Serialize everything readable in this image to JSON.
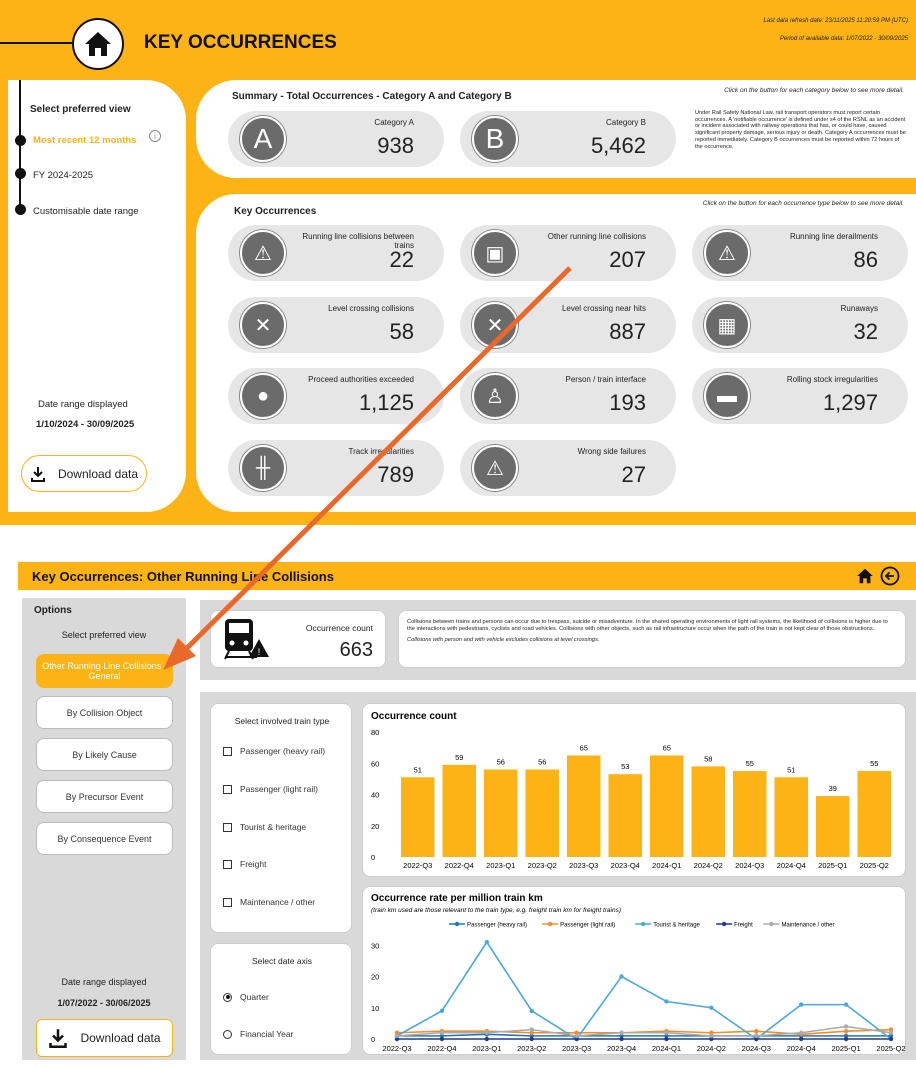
{
  "header": {
    "title": "KEY OCCURRENCES",
    "refresh": "Last data refresh date: 23/11/2025 11:20:59 PM (UTC)",
    "period": "Period of available data: 1/07/2022 - 30/09/2025"
  },
  "sidebar": {
    "heading": "Select preferred view",
    "options": [
      "Most recent 12 months",
      "FY 2024-2025",
      "Customisable date range"
    ],
    "range_label": "Date range displayed",
    "range_value": "1/10/2024 - 30/09/2025",
    "download": "Download data"
  },
  "summary": {
    "title": "Summary - Total Occurrences - Category A and Category B",
    "hint": "Click on the button for each category below to see more detail.",
    "desc": "Under Rail Safety National Law, rail transport operators must report certain occurrences. A 'notifiable occurrence' is defined under s4 of the RSNL as an accident or incident associated with railway operations that has, or could have, caused significant property damage, serious injury or death. Category A occurrences must be reported immediately. Category B occurrences must be reported within 72 hours of the occurrence.",
    "catA": {
      "icon": "A",
      "label": "Category A",
      "value": "938"
    },
    "catB": {
      "icon": "B",
      "label": "Category B",
      "value": "5,462"
    }
  },
  "key": {
    "title": "Key Occurrences",
    "hint": "Click on the button for each occurrence type below to see more detail.",
    "items": [
      {
        "label": "Running line collisions between trains",
        "value": "22",
        "icon": "train-collision-icon"
      },
      {
        "label": "Other running line collisions",
        "value": "207",
        "icon": "train-hazard-icon"
      },
      {
        "label": "Running line derailments",
        "value": "86",
        "icon": "derailment-icon"
      },
      {
        "label": "Level crossing collisions",
        "value": "58",
        "icon": "level-crossing-collision-icon"
      },
      {
        "label": "Level crossing near hits",
        "value": "887",
        "icon": "level-crossing-icon"
      },
      {
        "label": "Runaways",
        "value": "32",
        "icon": "barrier-icon"
      },
      {
        "label": "Proceed authorities exceeded",
        "value": "1,125",
        "icon": "signal-icon"
      },
      {
        "label": "Person / train interface",
        "value": "193",
        "icon": "person-train-icon"
      },
      {
        "label": "Rolling stock irregularities",
        "value": "1,297",
        "icon": "wagon-icon"
      },
      {
        "label": "Track irregularities",
        "value": "789",
        "icon": "track-icon"
      },
      {
        "label": "Wrong side failures",
        "value": "27",
        "icon": "warning-icon"
      }
    ]
  },
  "detail": {
    "title": "Key Occurrences: Other Running Line Collisions",
    "options_title": "Options",
    "select_view": "Select preferred view",
    "views": [
      "Other Running Line Collisions - General",
      "By Collision Object",
      "By Likely Cause",
      "By Precursor Event",
      "By Consequence Event"
    ],
    "range_label": "Date range displayed",
    "range_value": "1/07/2022 - 30/06/2025",
    "download": "Download data",
    "count_label": "Occurrence count",
    "count_value": "663",
    "desc1": "Collisions between trains and persons can occur due to trespass, suicide or misadventure. In the shared operating environments of light rail systems, the likelihood of collisions is higher due to the interactions with pedestrians, cyclists and road vehicles. Collisions with other objects, such as rail infrastructure occur when the path of the train is not kept clear of those obstructions.",
    "desc2": "Collisions with person and with vehicle excludes collisions at level crossings.",
    "train_type_title": "Select involved train type",
    "train_types": [
      "Passenger (heavy rail)",
      "Passenger (light rail)",
      "Tourist & heritage",
      "Freight",
      "Maintenance / other"
    ],
    "date_axis_title": "Select date axis",
    "date_axis": [
      "Quarter",
      "Financial Year"
    ],
    "date_axis_selected": "Quarter"
  },
  "colors": {
    "accent": "#FCB316",
    "arrow": "#E8692A"
  },
  "chart_data": [
    {
      "type": "bar",
      "title": "Occurrence count",
      "categories": [
        "2022-Q3",
        "2022-Q4",
        "2023-Q1",
        "2023-Q2",
        "2023-Q3",
        "2023-Q4",
        "2024-Q1",
        "2024-Q2",
        "2024-Q3",
        "2024-Q4",
        "2025-Q1",
        "2025-Q2"
      ],
      "values": [
        51,
        59,
        56,
        56,
        65,
        53,
        65,
        58,
        55,
        51,
        39,
        55
      ],
      "ylim": [
        0,
        80
      ],
      "yticks": [
        0,
        20,
        40,
        60,
        80
      ],
      "color": "#FCB316"
    },
    {
      "type": "line",
      "title": "Occurrence rate per million train km",
      "subtitle": "(train km used are those relevant to the train type, e.g. freight train km for freight trains)",
      "categories": [
        "2022-Q3",
        "2022-Q4",
        "2023-Q1",
        "2023-Q2",
        "2023-Q3",
        "2023-Q4",
        "2024-Q1",
        "2024-Q2",
        "2024-Q3",
        "2024-Q4",
        "2025-Q1",
        "2025-Q2"
      ],
      "ylim": [
        0,
        32
      ],
      "yticks": [
        0,
        10,
        20,
        30
      ],
      "series": [
        {
          "name": "Passenger (heavy rail)",
          "color": "#1f77b4",
          "values": [
            1,
            1,
            1.5,
            1,
            1,
            1,
            1,
            1,
            1,
            1,
            1,
            1
          ]
        },
        {
          "name": "Passenger (light rail)",
          "color": "#F28C28",
          "values": [
            2,
            2.5,
            2.5,
            2,
            2,
            2,
            2.5,
            2,
            2.5,
            1.5,
            2.5,
            3
          ]
        },
        {
          "name": "Tourist & heritage",
          "color": "#4AA8D8",
          "values": [
            1,
            9,
            31,
            9,
            0,
            20,
            12,
            10,
            0,
            11,
            11,
            0
          ]
        },
        {
          "name": "Freight",
          "color": "#1f3a93",
          "values": [
            0,
            0,
            0,
            0,
            0,
            0,
            0,
            0,
            0,
            0,
            0,
            0
          ]
        },
        {
          "name": "Maintenance / other",
          "color": "#aaaaaa",
          "values": [
            1,
            2,
            2,
            3,
            1,
            2,
            2,
            1,
            1,
            2,
            4,
            2
          ]
        }
      ]
    }
  ]
}
